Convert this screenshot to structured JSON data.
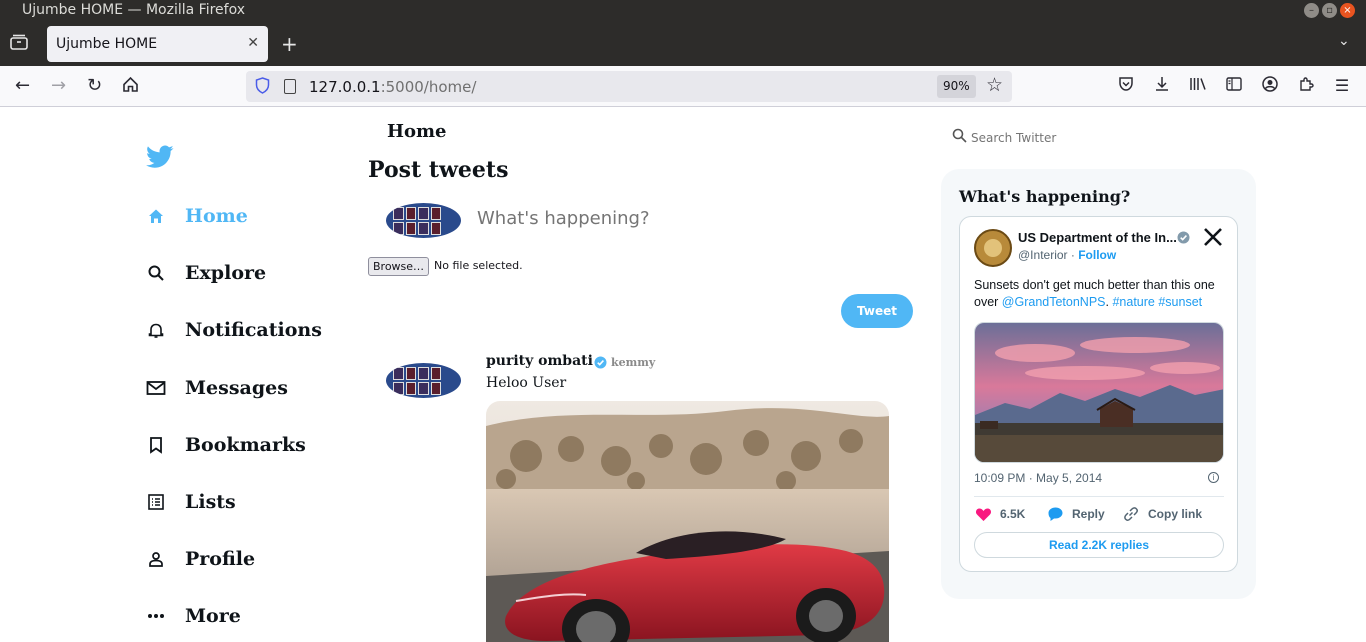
{
  "window": {
    "title": "Ujumbe HOME — Mozilla Firefox"
  },
  "tab": {
    "title": "Ujumbe HOME"
  },
  "urlbar": {
    "host": "127.0.0.1",
    "rest": ":5000/home/",
    "zoom": "90%"
  },
  "sidebar": {
    "items": [
      {
        "label": "Home",
        "icon": "home-icon",
        "active": true
      },
      {
        "label": "Explore",
        "icon": "search-icon"
      },
      {
        "label": "Notifications",
        "icon": "bell-icon"
      },
      {
        "label": "Messages",
        "icon": "mail-icon"
      },
      {
        "label": "Bookmarks",
        "icon": "bookmark-icon"
      },
      {
        "label": "Lists",
        "icon": "list-icon"
      },
      {
        "label": "Profile",
        "icon": "person-icon"
      },
      {
        "label": "More",
        "icon": "more-icon"
      }
    ]
  },
  "main": {
    "header": "Home",
    "compose": {
      "title": "Post tweets",
      "placeholder": "What's happening?",
      "browse_label": "Browse…",
      "file_status": "No file selected.",
      "tweet_label": "Tweet"
    },
    "post": {
      "name": "purity ombati",
      "handle": "kemmy",
      "text": "Heloo User"
    }
  },
  "right": {
    "search_placeholder": "Search Twitter",
    "widget_title": "What's happening?",
    "embed": {
      "name": "US Department of the In...",
      "handle": "@Interior",
      "separator": " · ",
      "follow": "Follow",
      "text_prefix": "Sunsets don't get much better than this one over ",
      "mention": "@GrandTetonNPS",
      "text_mid": ". ",
      "tags": "#nature #sunset",
      "time": "10:09 PM · May 5, 2014",
      "likes": "6.5K",
      "reply": "Reply",
      "copy": "Copy link",
      "read_replies": "Read 2.2K replies"
    }
  },
  "colors": {
    "accent": "#50b7f5",
    "twitter_blue": "#1d9bf0",
    "like": "#f91880"
  }
}
